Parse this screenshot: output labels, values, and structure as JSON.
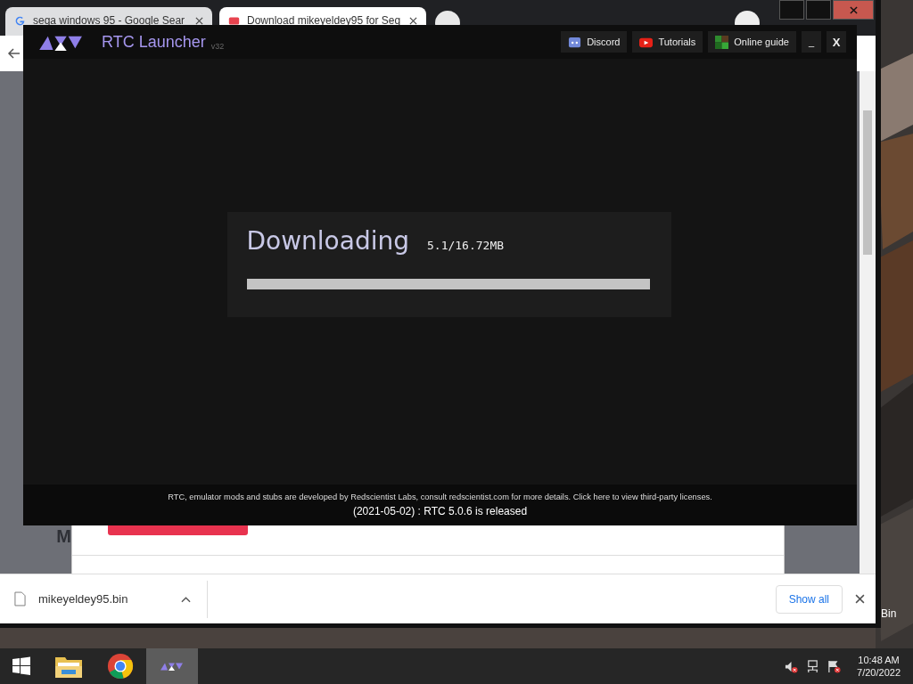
{
  "browser": {
    "tabs": [
      {
        "kind": "google",
        "title": "sega windows 95 - Google Sear",
        "selected": false
      },
      {
        "kind": "site",
        "title": "Download mikeyeldey95 for Seg",
        "selected": true
      }
    ],
    "page_letter": "M"
  },
  "launcher": {
    "title": "RTC Launcher",
    "version": "v32",
    "links": [
      {
        "kind": "discord",
        "label": "Discord"
      },
      {
        "kind": "youtube",
        "label": "Tutorials"
      },
      {
        "kind": "guide",
        "label": "Online guide"
      }
    ],
    "minimize": "_",
    "close": "X",
    "status": "Downloading",
    "progress_text": "5.1/16.72MB",
    "level": 1,
    "footer": "RTC, emulator mods and stubs are developed by Redscientist Labs, consult redscientist.com for more details. Click here to view third-party licenses.",
    "news": "(2021-05-02) : RTC 5.0.6 is released"
  },
  "downloads": {
    "file": "mikeyeldey95.bin",
    "show_all": "Show all"
  },
  "desktop": {
    "icon_label": "Bin"
  },
  "taskbar": {
    "apps": [
      {
        "kind": "explorer",
        "selected": false
      },
      {
        "kind": "chrome",
        "selected": false
      },
      {
        "kind": "rtc",
        "selected": true
      }
    ],
    "time": "10:48 AM",
    "date": "7/20/2022"
  }
}
